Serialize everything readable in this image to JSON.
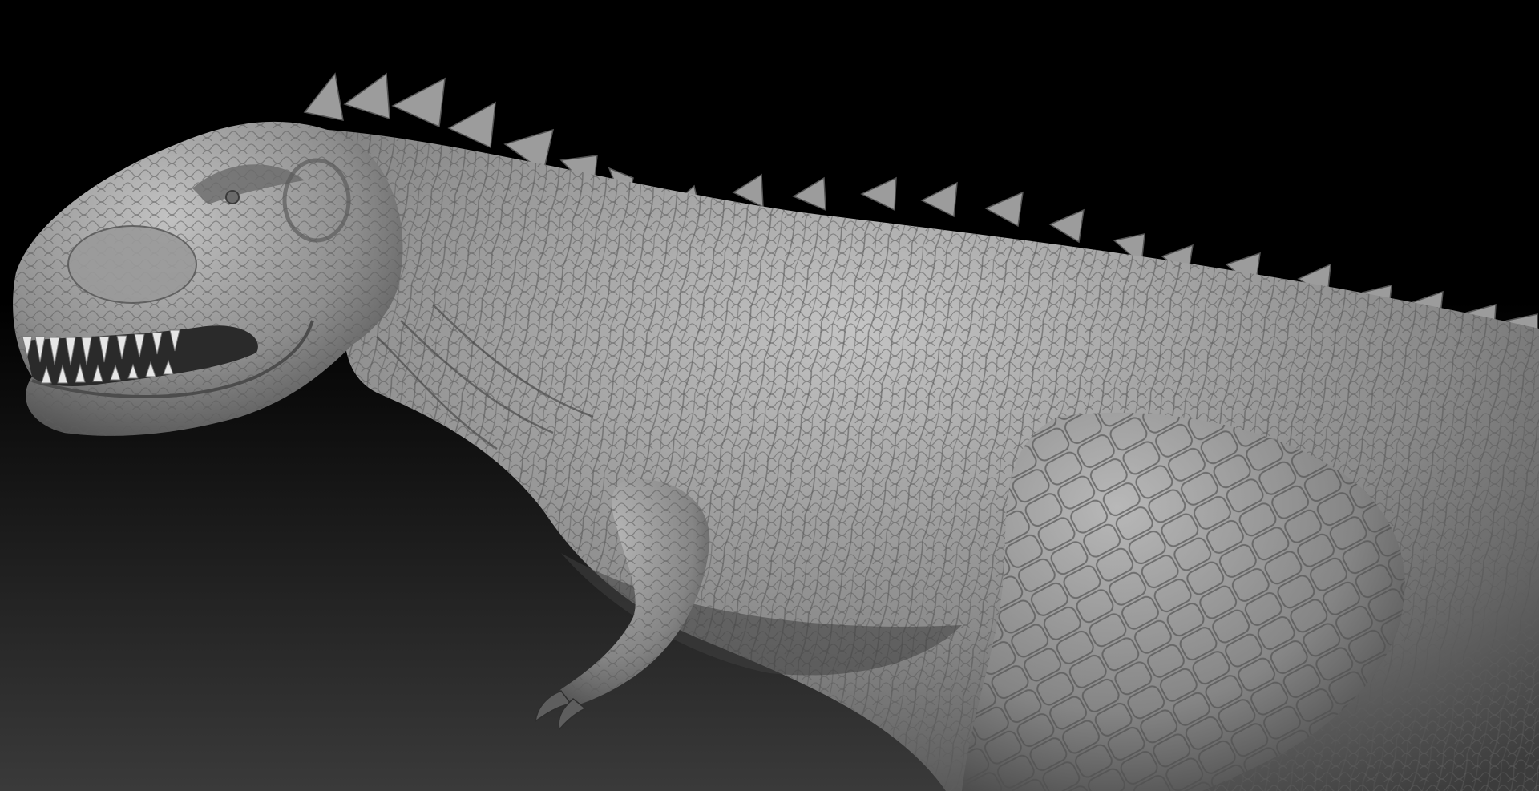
{
  "scene": {
    "subject": "sculpted-dinosaur",
    "background": {
      "top_color": "#000000",
      "bottom_color": "#3a3a3a"
    },
    "model_color": "#8a8a8a",
    "highlight_color": "#c4c4c4",
    "shadow_color": "#3c3c3c",
    "tooth_color": "#e6e6e6"
  }
}
